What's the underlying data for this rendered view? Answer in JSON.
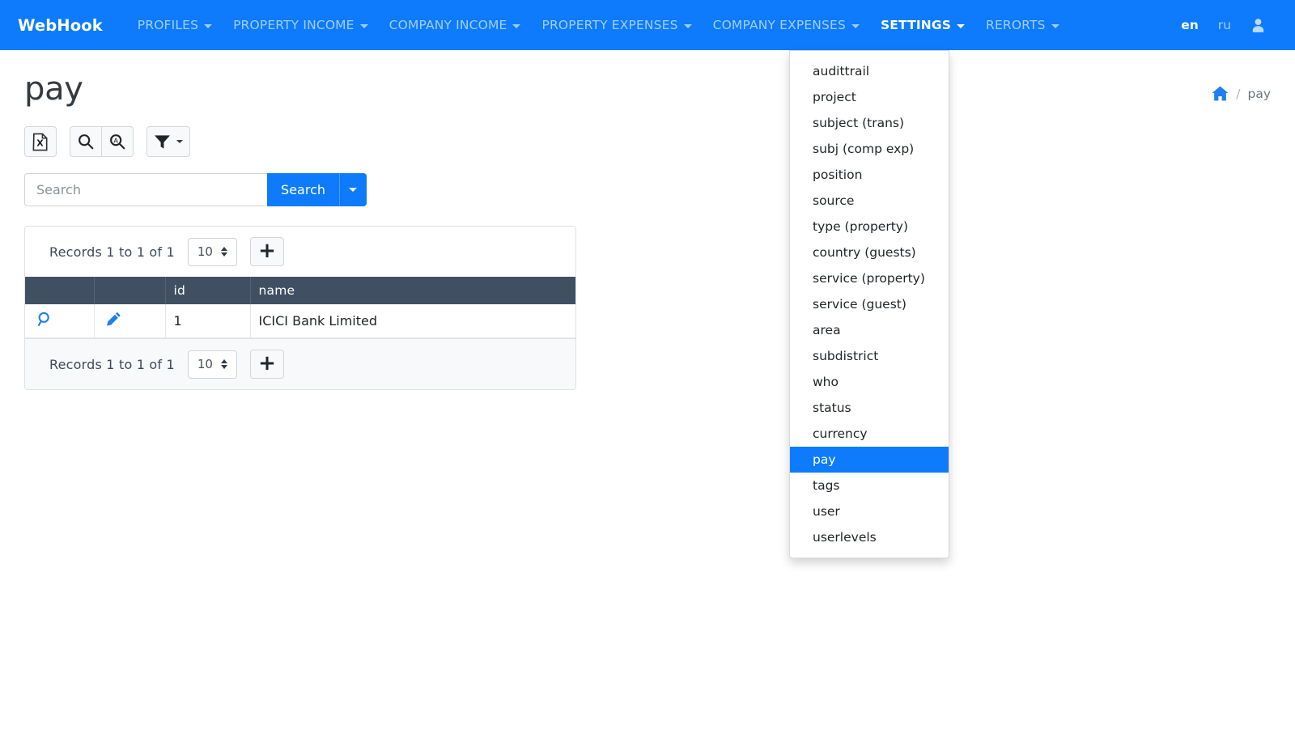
{
  "navbar": {
    "brand": "WebHook",
    "items": [
      {
        "label": "PROFILES",
        "active": false,
        "caret": true
      },
      {
        "label": "PROPERTY INCOME",
        "active": false,
        "caret": true
      },
      {
        "label": "COMPANY INCOME",
        "active": false,
        "caret": true
      },
      {
        "label": "PROPERTY EXPENSES",
        "active": false,
        "caret": true
      },
      {
        "label": "COMPANY EXPENSES",
        "active": false,
        "caret": true
      },
      {
        "label": "SETTINGS",
        "active": true,
        "caret": true
      },
      {
        "label": "RERORTS",
        "active": false,
        "caret": true
      }
    ],
    "languages": [
      {
        "label": "en",
        "active": true
      },
      {
        "label": "ru",
        "active": false
      }
    ],
    "user_icon": "user-icon",
    "background_color": "#0d7bfb"
  },
  "settings_menu": {
    "open": true,
    "selected": "pay",
    "highlight_color": "#0d7bfb",
    "items": [
      "audittrail",
      "project",
      "subject (trans)",
      "subj (comp exp)",
      "position",
      "source",
      "type (property)",
      "country (guests)",
      "service (property)",
      "service (guest)",
      "area",
      "subdistrict",
      "who",
      "status",
      "currency",
      "pay",
      "tags",
      "user",
      "userlevels"
    ]
  },
  "page": {
    "title": "pay",
    "breadcrumb": {
      "home_icon": "home-icon",
      "separator": "/",
      "current": "pay"
    }
  },
  "toolbar": {
    "export_excel": {
      "icon": "excel-file-icon",
      "label": ""
    },
    "search_simple": {
      "icon": "search-icon",
      "label": ""
    },
    "search_advanced": {
      "icon": "search-advanced-icon",
      "label": ""
    },
    "filter": {
      "icon": "filter-icon",
      "label": ""
    }
  },
  "search": {
    "placeholder": "Search",
    "value": "",
    "button_label": "Search",
    "dropdown_icon": "chevron-down-icon"
  },
  "table_panel": {
    "header_records_text": "Records 1 to 1 of 1",
    "footer_records_text": "Records 1 to 1 of 1",
    "page_size_value": "10",
    "add_label": "+",
    "header_bg": "#414f62",
    "columns": [
      "",
      "",
      "id",
      "name"
    ],
    "rows": [
      {
        "view_icon": "magnifier-icon",
        "edit_icon": "pencil-icon",
        "id": "1",
        "name": "ICICI Bank Limited"
      }
    ]
  }
}
